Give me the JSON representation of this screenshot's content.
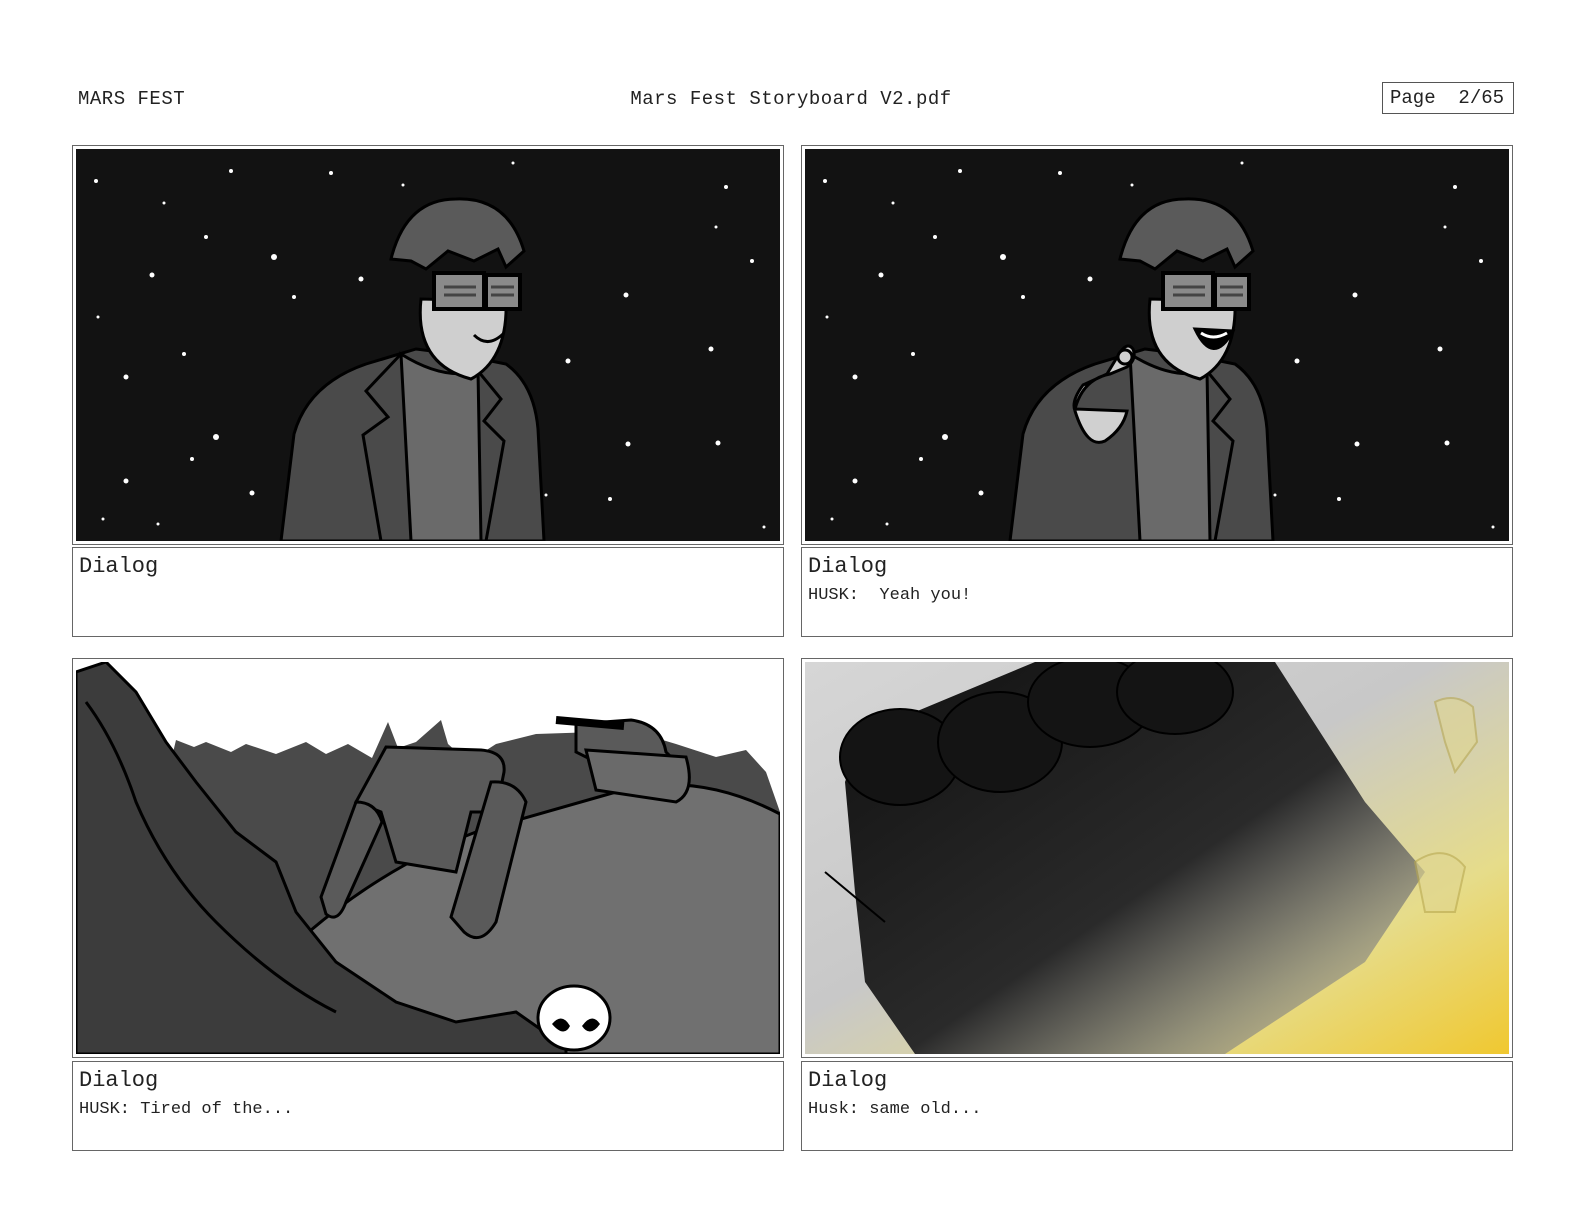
{
  "header": {
    "project": "MARS FEST",
    "filename": "Mars Fest Storyboard V2.pdf",
    "page_label": "Page",
    "page_number": "2/65"
  },
  "panels": [
    {
      "dialog_title": "Dialog",
      "dialog_text": ""
    },
    {
      "dialog_title": "Dialog",
      "dialog_text": "HUSK:  Yeah you!"
    },
    {
      "dialog_title": "Dialog",
      "dialog_text": "HUSK: Tired of the..."
    },
    {
      "dialog_title": "Dialog",
      "dialog_text": "Husk: same old..."
    }
  ]
}
